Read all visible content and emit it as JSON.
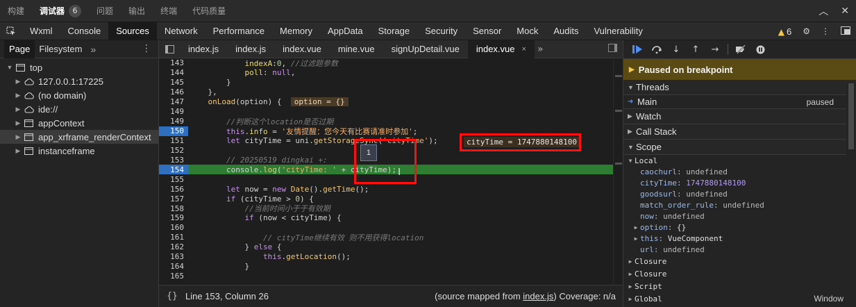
{
  "topbar": {
    "tabs": [
      "构建",
      "调试器",
      "问题",
      "输出",
      "终端",
      "代码质量"
    ],
    "active": "调试器",
    "badge": "6"
  },
  "panels": {
    "tabs": [
      "Wxml",
      "Console",
      "Sources",
      "Network",
      "Performance",
      "Memory",
      "AppData",
      "Storage",
      "Security",
      "Sensor",
      "Mock",
      "Audits",
      "Vulnerability"
    ],
    "active": "Sources",
    "warning_count": "6"
  },
  "navigator": {
    "tabs": [
      "Page",
      "Filesystem"
    ],
    "more": "»",
    "tree": [
      {
        "label": "top",
        "indent": 0,
        "arrow": "▼",
        "icon": "window-icon"
      },
      {
        "label": "127.0.0.1:17225",
        "indent": 1,
        "arrow": "▶",
        "icon": "cloud-icon"
      },
      {
        "label": "(no domain)",
        "indent": 1,
        "arrow": "▶",
        "icon": "cloud-icon"
      },
      {
        "label": "ide://",
        "indent": 1,
        "arrow": "▶",
        "icon": "cloud-icon"
      },
      {
        "label": "appContext",
        "indent": 1,
        "arrow": "▶",
        "icon": "window-icon"
      },
      {
        "label": "app_xrframe_renderContext",
        "indent": 1,
        "arrow": "▶",
        "icon": "window-icon",
        "selected": true
      },
      {
        "label": "instanceframe",
        "indent": 1,
        "arrow": "▶",
        "icon": "window-icon"
      }
    ]
  },
  "editor": {
    "files": [
      "index.js",
      "index.js",
      "index.vue",
      "mine.vue",
      "signUpDetail.vue",
      "index.vue"
    ],
    "active_index": 5,
    "close": "×",
    "more": "»",
    "inline_value": "cityTime = 1747880148100",
    "hover_count": "1",
    "status": {
      "braces": "{}",
      "position": "Line 153, Column 26",
      "mapped_prefix": "(source mapped from ",
      "mapped_file": "index.js",
      "mapped_suffix": ")",
      "coverage": "Coverage: n/a"
    }
  },
  "debugger": {
    "paused": "Paused on breakpoint",
    "sections": {
      "threads": "Threads",
      "watch": "Watch",
      "callstack": "Call Stack",
      "scope": "Scope"
    },
    "thread": {
      "name": "Main",
      "status": "paused"
    },
    "scope": {
      "local": "Local",
      "closure1": "Closure",
      "closure2": "Closure",
      "script": "Script",
      "global": "Global",
      "global_value": "Window",
      "vars": [
        {
          "key": "caochurl",
          "value": "undefined",
          "kind": "undef"
        },
        {
          "key": "cityTime",
          "value": "1747880148100",
          "kind": "num"
        },
        {
          "key": "goodsurl",
          "value": "undefined",
          "kind": "undef"
        },
        {
          "key": "match_order_rule",
          "value": "undefined",
          "kind": "undef"
        },
        {
          "key": "now",
          "value": "undefined",
          "kind": "undef"
        },
        {
          "key": "option",
          "value": "{}",
          "kind": "obj",
          "expandable": true
        },
        {
          "key": "this",
          "value": "VueComponent",
          "kind": "obj",
          "expandable": true
        },
        {
          "key": "url",
          "value": "undefined",
          "kind": "undef"
        }
      ]
    }
  },
  "code_lines": [
    {
      "n": "143",
      "html": "            <span class=\"prop\">indexA</span>:<span class=\"num\">0</span>, <span class=\"cmt\">//过滤题参数</span>"
    },
    {
      "n": "144",
      "html": "            <span class=\"prop\">poll</span>: <span class=\"kb\">null</span>,"
    },
    {
      "n": "145",
      "html": "        }"
    },
    {
      "n": "146",
      "html": "    },"
    },
    {
      "n": "147",
      "html": "    <span class=\"fn\">onLoad</span>(option) {  <span class=\"inl\">option = {}</span>"
    },
    {
      "n": "149",
      "html": ""
    },
    {
      "n": "149",
      "html": "        <span class=\"cmt\">//判断这个location是否过期</span>"
    },
    {
      "n": "150",
      "bp": true,
      "html": "        <span class=\"kb\">this</span>.<span class=\"prop\">info</span> = <span class=\"str\">'友情提醒：您今天有比赛请准时参加'</span>;"
    },
    {
      "n": "151",
      "html": "        <span class=\"kb\">let</span> cityTime = uni.<span class=\"fn\">getStorageSync</span>(<span class=\"str\">'cityTime'</span>);"
    },
    {
      "n": "152",
      "html": ""
    },
    {
      "n": "153",
      "html": "        <span class=\"cmt\">// 20250519 dingkai +:</span>"
    },
    {
      "n": "154",
      "cur": true,
      "html": "        console.<span class=\"fn\">log</span>(<span class=\"str\">'cityTime: '</span> + cityTime);"
    },
    {
      "n": "155",
      "html": ""
    },
    {
      "n": "156",
      "html": "        <span class=\"kb\">let</span> now = <span class=\"kb\">new</span> <span class=\"fn\">Date</span>().<span class=\"fn\">getTime</span>();"
    },
    {
      "n": "157",
      "html": "        <span class=\"kb\">if</span> (cityTime &gt; <span class=\"num\">0</span>) {"
    },
    {
      "n": "158",
      "html": "            <span class=\"cmt\">//当前时间小于于有效期</span>"
    },
    {
      "n": "159",
      "html": "            <span class=\"kb\">if</span> (now &lt; cityTime) {"
    },
    {
      "n": "160",
      "html": ""
    },
    {
      "n": "161",
      "html": "                <span class=\"cmt\">// cityTime继续有效 则不用获得location</span>"
    },
    {
      "n": "162",
      "html": "            } <span class=\"kb\">else</span> {"
    },
    {
      "n": "163",
      "html": "                <span class=\"kb\">this</span>.<span class=\"fn\">getLocation</span>();"
    },
    {
      "n": "164",
      "html": "            }"
    },
    {
      "n": "165",
      "html": ""
    }
  ]
}
